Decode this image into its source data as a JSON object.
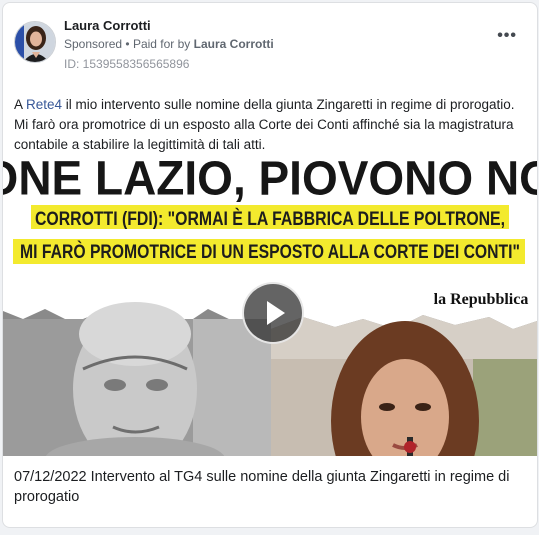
{
  "post": {
    "author": "Laura Corrotti",
    "sponsored_label": "Sponsored",
    "separator": "•",
    "paid_for_prefix": "Paid for by",
    "paid_for_by": "Laura Corrotti",
    "ad_id": "ID: 1539558356565896",
    "more_icon": "more-horizontal-icon",
    "text_prefix": "A ",
    "text_link": "Rete4",
    "text_body": " il mio intervento sulle nomine della giunta Zingaretti in regime di prorogatio. Mi farò ora promotrice di un esposto alla Corte dei Conti affinché sia la magistratura contabile a stabilire la legittimità di tali atti.",
    "caption": "07/12/2022 Intervento al TG4 sulle nomine della giunta Zingaretti in regime di prorogatio"
  },
  "media": {
    "headline": "REGIONE LAZIO, PIOVONO NOMINE",
    "subhead_line1": "CORROTTI (FDI): \"ORMAI È LA FABBRICA DELLE POLTRONE,",
    "subhead_line2": "MI FARÒ PROMOTRICE DI UN ESPOSTO ALLA CORTE DEI CONTI\"",
    "source": "la Repubblica",
    "play_icon": "play-icon"
  },
  "colors": {
    "link": "#385898",
    "highlight": "#f3ea2e",
    "muted": "#606770"
  }
}
